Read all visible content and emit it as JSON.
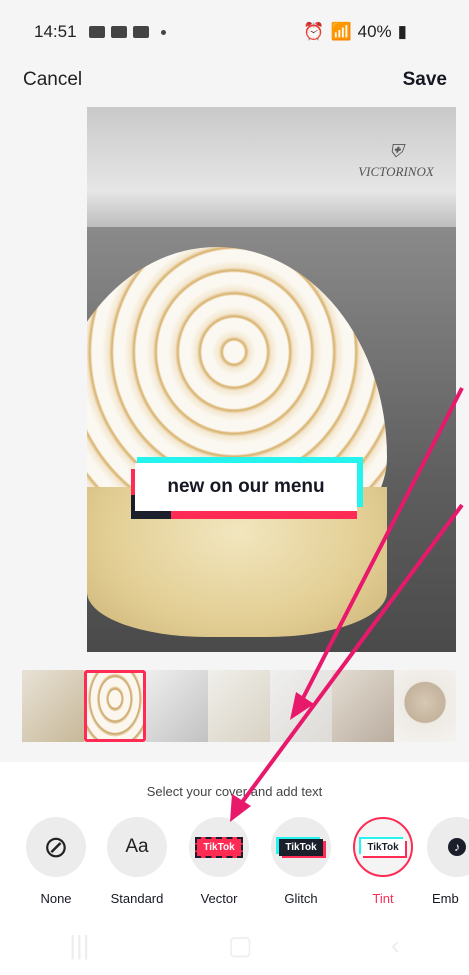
{
  "status_bar": {
    "time": "14:51",
    "battery": "40%"
  },
  "header": {
    "cancel_label": "Cancel",
    "save_label": "Save"
  },
  "preview": {
    "brand_text": "VICTORINOX",
    "overlay_text": "new on our menu"
  },
  "thumbnails": {
    "count": 7,
    "selected_index": 1
  },
  "instruction": "Select your cover and add text",
  "styles": [
    {
      "label": "None"
    },
    {
      "label": "Standard",
      "glyph": "Aa"
    },
    {
      "label": "Vector",
      "badge": "TikTok"
    },
    {
      "label": "Glitch",
      "badge": "TikTok"
    },
    {
      "label": "Tint",
      "badge": "TikTok",
      "selected": true
    },
    {
      "label": "Emb"
    }
  ],
  "colors": {
    "accent": "#fe2c55",
    "cyan": "#25f4ee",
    "arrow": "#e8186a"
  }
}
